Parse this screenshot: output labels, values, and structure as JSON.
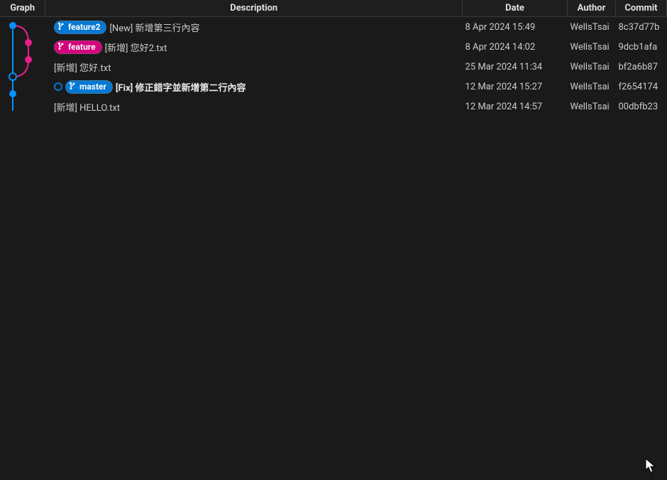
{
  "headers": {
    "graph": "Graph",
    "description": "Description",
    "date": "Date",
    "author": "Author",
    "commit": "Commit"
  },
  "commits": [
    {
      "branch": "feature2",
      "branchColor": "blue",
      "isHead": false,
      "message": "[New] 新增第三行內容",
      "bold": false,
      "date": "8 Apr 2024 15:49",
      "author": "WellsTsai",
      "hash": "8c37d77b"
    },
    {
      "branch": "feature",
      "branchColor": "pink",
      "isHead": false,
      "message": "[新增] 您好2.txt",
      "bold": false,
      "date": "8 Apr 2024 14:02",
      "author": "WellsTsai",
      "hash": "9dcb1afa"
    },
    {
      "branch": null,
      "branchColor": null,
      "isHead": false,
      "message": "[新增] 您好.txt",
      "bold": false,
      "date": "25 Mar 2024 11:34",
      "author": "WellsTsai",
      "hash": "bf2a6b87"
    },
    {
      "branch": "master",
      "branchColor": "blue",
      "isHead": true,
      "message": "[Fix] 修正錯字並新增第二行內容",
      "bold": true,
      "date": "12 Mar 2024 15:27",
      "author": "WellsTsai",
      "hash": "f2654174"
    },
    {
      "branch": null,
      "branchColor": null,
      "isHead": false,
      "message": "[新增] HELLO.txt",
      "bold": false,
      "date": "12 Mar 2024 14:57",
      "author": "WellsTsai",
      "hash": "00dbfb23"
    }
  ]
}
